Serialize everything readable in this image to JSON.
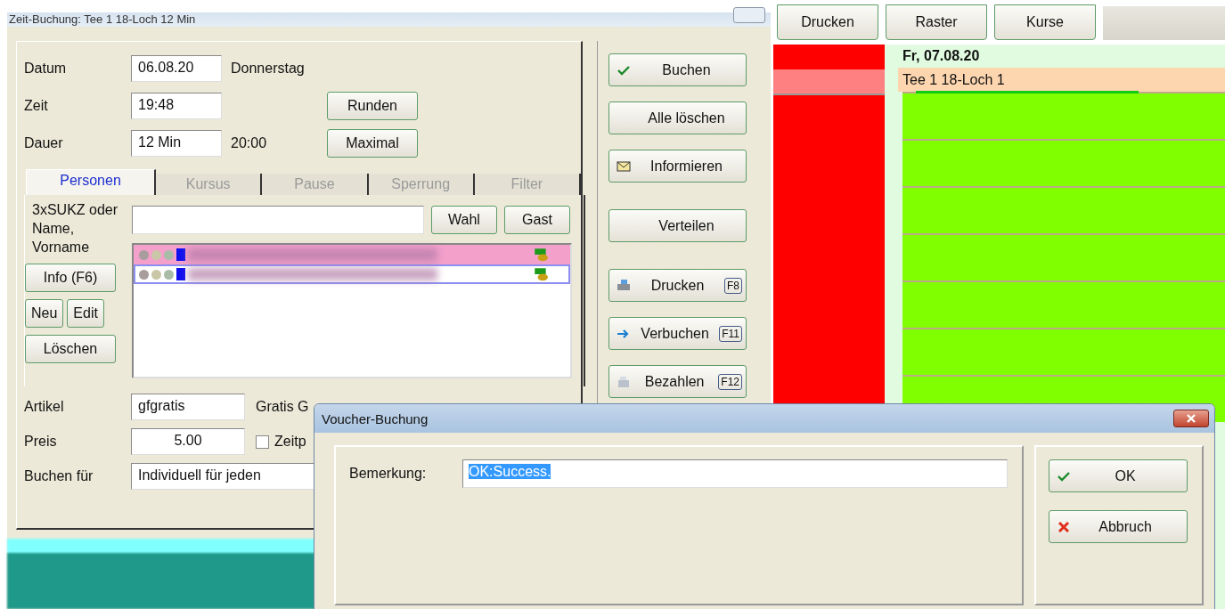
{
  "window": {
    "title": "Zeit-Buchung: Tee 1 18-Loch 12 Min"
  },
  "form": {
    "fields": [
      {
        "label": "Datum",
        "value": "06.08.20",
        "note": "Donnerstag"
      },
      {
        "label": "Zeit",
        "value": "19:48",
        "button": "Runden"
      },
      {
        "label": "Dauer",
        "value": "12 Min",
        "note": "20:00",
        "button": "Maximal"
      }
    ]
  },
  "tabs": [
    {
      "label": "Personen",
      "selected": true
    },
    {
      "label": "Kursus",
      "selected": false
    },
    {
      "label": "Pause",
      "selected": false
    },
    {
      "label": "Sperrung",
      "selected": false
    },
    {
      "label": "Filter",
      "selected": false
    }
  ],
  "persons": {
    "search_label": "3xSUKZ oder Name, Vorname",
    "search_buttons": [
      "Wahl",
      "Gast"
    ],
    "info_button": "Info (F6)",
    "edit_buttons": [
      "Neu",
      "Edit"
    ],
    "delete_button": "Löschen",
    "rows": [
      {
        "color": "#f3a0cb",
        "selected": false
      },
      {
        "color": "#ffffff",
        "selected": true
      }
    ]
  },
  "article": {
    "label": "Artikel",
    "value": "gfgratis",
    "description": "Gratis G"
  },
  "price": {
    "label": "Preis",
    "value": "5.00",
    "checkbox": {
      "label": "Zeitp",
      "checked": false
    }
  },
  "book_for": {
    "label": "Buchen für",
    "value": "Individuell für jeden"
  },
  "action_groups": [
    [
      {
        "label": "Buchen",
        "kind": "check"
      },
      {
        "label": "Alle löschen",
        "kind": "plain"
      },
      {
        "label": "Informieren",
        "kind": "mail"
      }
    ],
    [
      {
        "label": "Verteilen",
        "kind": "plain"
      }
    ],
    [
      {
        "label": "Drucken",
        "kind": "printer",
        "key": "F8"
      },
      {
        "label": "Verbuchen",
        "kind": "arrow",
        "key": "F11"
      },
      {
        "label": "Bezahlen",
        "kind": "cash",
        "key": "F12"
      }
    ]
  ],
  "toolbar": [
    "Drucken",
    "Raster",
    "Kurse"
  ],
  "calendar": {
    "date": "Fr, 07.08.20",
    "resource": "Tee 1 18-Loch 1"
  },
  "dialog": {
    "title": "Voucher-Buchung",
    "field_label": "Bemerkung:",
    "field_value": "OK:Success.",
    "buttons": [
      {
        "label": "OK",
        "kind": "ok"
      },
      {
        "label": "Abbruch",
        "kind": "cancel"
      }
    ]
  }
}
